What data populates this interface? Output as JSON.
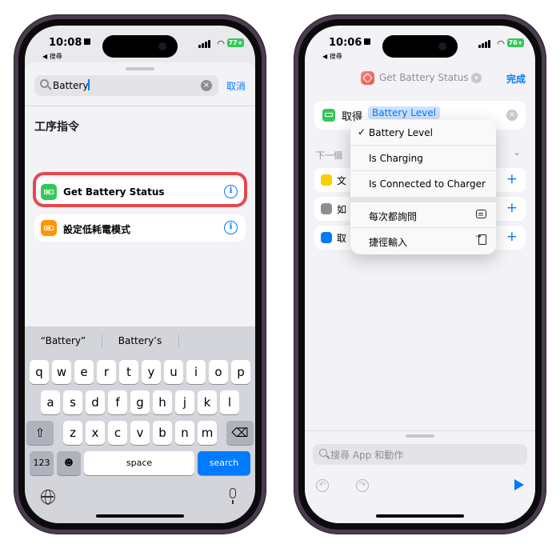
{
  "left_phone": {
    "status": {
      "time": "10:08",
      "back": "◀ 搜尋",
      "battery": "77+"
    },
    "search": {
      "query": "Battery",
      "cancel": "取消"
    },
    "section_title": "工序指令",
    "results": [
      {
        "label": "Get Battery Status",
        "color": "#34c759"
      },
      {
        "label": "設定低耗電模式",
        "color": "#ff9500"
      }
    ],
    "keyboard": {
      "suggestions": [
        "“Battery”",
        "Battery’s",
        ""
      ],
      "row1": [
        "q",
        "w",
        "e",
        "r",
        "t",
        "y",
        "u",
        "i",
        "o",
        "p"
      ],
      "row2": [
        "a",
        "s",
        "d",
        "f",
        "g",
        "h",
        "j",
        "k",
        "l"
      ],
      "row3": [
        "z",
        "x",
        "c",
        "v",
        "b",
        "n",
        "m"
      ],
      "shift": "⇧",
      "delete": "⌫",
      "num": "123",
      "emoji": "☻",
      "space": "space",
      "go": "search"
    }
  },
  "right_phone": {
    "status": {
      "time": "10:06",
      "back": "◀ 搜尋",
      "battery": "76+"
    },
    "nav": {
      "title": "Get Battery Status",
      "done": "完成"
    },
    "action": {
      "verb": "取得",
      "token": "Battery Level"
    },
    "next_label": "下一個",
    "suggestions": [
      {
        "text": "文",
        "color": "#ffcc00"
      },
      {
        "text": "如",
        "color": "#8e8e93"
      },
      {
        "text": "取",
        "color": "#007aff"
      }
    ],
    "menu": {
      "check": "✓",
      "items": [
        "Battery Level",
        "Is Charging",
        "Is Connected to Charger"
      ],
      "extra": [
        "每次都詢問",
        "捷徑輸入"
      ]
    },
    "bottom": {
      "search_placeholder": "搜尋 App 和動作"
    }
  }
}
